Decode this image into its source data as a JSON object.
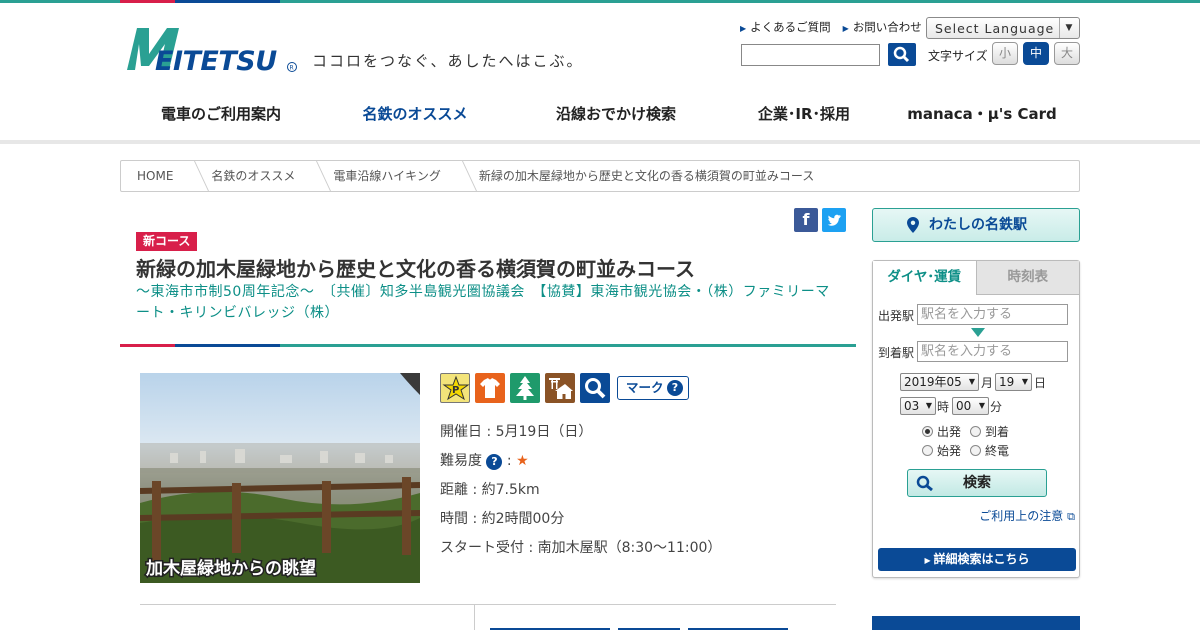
{
  "header": {
    "logo_text": "MEITETSU",
    "tagline": "ココロをつなぐ、あしたへはこぶ。",
    "util_links": [
      "よくあるご質問",
      "お問い合わせ"
    ],
    "language_select": "Select Language",
    "font_size_label": "文字サイズ",
    "font_sizes": [
      "小",
      "中",
      "大"
    ],
    "font_size_selected": "中"
  },
  "global_nav": {
    "items": [
      "電車のご利用案内",
      "名鉄のオススメ",
      "沿線おでかけ検索",
      "企業･IR･採用",
      "manaca・μ's Card"
    ],
    "active": "名鉄のオススメ"
  },
  "breadcrumb": [
    "HOME",
    "名鉄のオススメ",
    "電車沿線ハイキング",
    "新緑の加木屋緑地から歴史と文化の香る横須賀の町並みコース"
  ],
  "colors": {
    "brand_blue": "#0a4a96",
    "accent_teal": "#2aa093",
    "accent_red": "#d81f4a"
  },
  "course": {
    "badge": "新コース",
    "title": "新緑の加木屋緑地から歴史と文化の香る横須賀の町並みコース",
    "subtitle": "～東海市市制50周年記念～　〔共催〕知多半島観光圏協議会　【協賛】東海市観光協会・（株）ファミリーマート・キリンビバレッジ（株）",
    "photo_caption": "加木屋緑地からの眺望",
    "mark_button": "マーク",
    "icons": [
      "parking-icon",
      "shirt-icon",
      "tree-icon",
      "shrine-icon",
      "search-icon"
    ],
    "date": "開催日 : 5月19日（日）",
    "difficulty_label": "難易度",
    "difficulty_stars": "★",
    "distance": "距離 : 約7.5km",
    "time": "時間 : 約2時間00分",
    "start": "スタート受付 : 南加木屋駅（8:30～11:00）"
  },
  "share": {
    "facebook": "f",
    "twitter": "t"
  },
  "sidebar": {
    "my_station": "わたしの名鉄駅",
    "tabs": [
      "ダイヤ･運賃",
      "時刻表"
    ],
    "from_label": "出発駅",
    "to_label": "到着駅",
    "station_placeholder": "駅名を入力する",
    "year_month": "2019年05",
    "month_unit": "月",
    "day": "19",
    "day_unit": "日",
    "hour": "03",
    "hour_unit": "時",
    "minute": "00",
    "minute_unit": "分",
    "radios": [
      "出発",
      "到着",
      "始発",
      "終電"
    ],
    "radio_selected": "出発",
    "search_button": "検索",
    "notice_link": "ご利用上の注意",
    "detail_button": "詳細検索はこちら"
  }
}
